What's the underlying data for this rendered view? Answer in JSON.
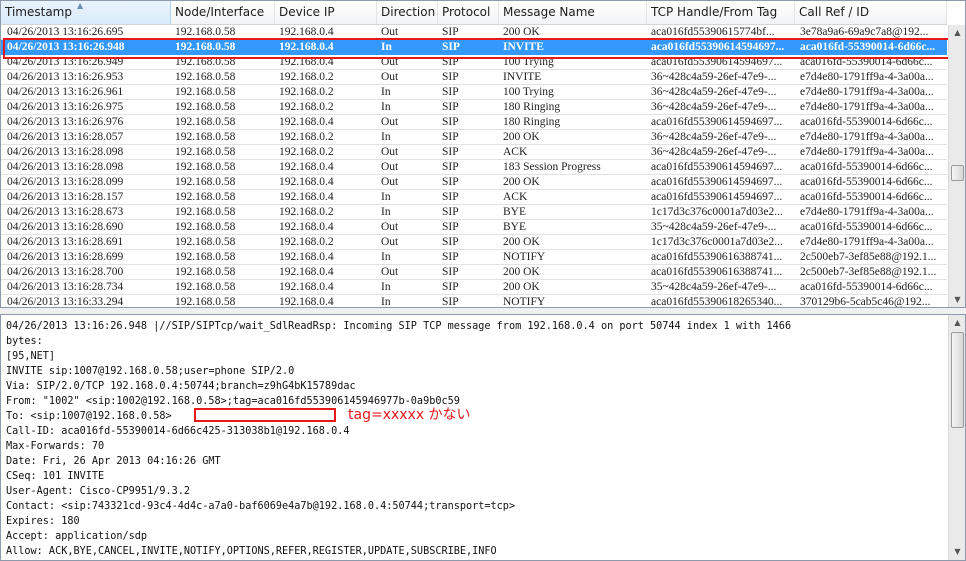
{
  "table": {
    "columns": [
      "Timestamp",
      "Node/Interface",
      "Device IP",
      "Direction",
      "Protocol",
      "Message Name",
      "TCP Handle/From Tag",
      "Call Ref / ID"
    ],
    "rows": [
      [
        "04/26/2013 13:16:26.695",
        "192.168.0.58",
        "192.168.0.4",
        "Out",
        "SIP",
        "200 OK",
        "aca016fd55390615774bf...",
        "3e78a9a6-69a9c7a8@192..."
      ],
      [
        "04/26/2013 13:16:26.948",
        "192.168.0.58",
        "192.168.0.4",
        "In",
        "SIP",
        "INVITE",
        "aca016fd55390614594697...",
        "aca016fd-55390014-6d66c..."
      ],
      [
        "04/26/2013 13:16:26.949",
        "192.168.0.58",
        "192.168.0.4",
        "Out",
        "SIP",
        "100 Trying",
        "aca016fd55390614594697...",
        "aca016fd-55390014-6d66c..."
      ],
      [
        "04/26/2013 13:16:26.953",
        "192.168.0.58",
        "192.168.0.2",
        "Out",
        "SIP",
        "INVITE",
        "36~428c4a59-26ef-47e9-...",
        "e7d4e80-1791ff9a-4-3a00a..."
      ],
      [
        "04/26/2013 13:16:26.961",
        "192.168.0.58",
        "192.168.0.2",
        "In",
        "SIP",
        "100 Trying",
        "36~428c4a59-26ef-47e9-...",
        "e7d4e80-1791ff9a-4-3a00a..."
      ],
      [
        "04/26/2013 13:16:26.975",
        "192.168.0.58",
        "192.168.0.2",
        "In",
        "SIP",
        "180 Ringing",
        "36~428c4a59-26ef-47e9-...",
        "e7d4e80-1791ff9a-4-3a00a..."
      ],
      [
        "04/26/2013 13:16:26.976",
        "192.168.0.58",
        "192.168.0.4",
        "Out",
        "SIP",
        "180 Ringing",
        "aca016fd55390614594697...",
        "aca016fd-55390014-6d66c..."
      ],
      [
        "04/26/2013 13:16:28.057",
        "192.168.0.58",
        "192.168.0.2",
        "In",
        "SIP",
        "200 OK",
        "36~428c4a59-26ef-47e9-...",
        "e7d4e80-1791ff9a-4-3a00a..."
      ],
      [
        "04/26/2013 13:16:28.098",
        "192.168.0.58",
        "192.168.0.2",
        "Out",
        "SIP",
        "ACK",
        "36~428c4a59-26ef-47e9-...",
        "e7d4e80-1791ff9a-4-3a00a..."
      ],
      [
        "04/26/2013 13:16:28.098",
        "192.168.0.58",
        "192.168.0.4",
        "Out",
        "SIP",
        "183 Session Progress",
        "aca016fd55390614594697...",
        "aca016fd-55390014-6d66c..."
      ],
      [
        "04/26/2013 13:16:28.099",
        "192.168.0.58",
        "192.168.0.4",
        "Out",
        "SIP",
        "200 OK",
        "aca016fd55390614594697...",
        "aca016fd-55390014-6d66c..."
      ],
      [
        "04/26/2013 13:16:28.157",
        "192.168.0.58",
        "192.168.0.4",
        "In",
        "SIP",
        "ACK",
        "aca016fd55390614594697...",
        "aca016fd-55390014-6d66c..."
      ],
      [
        "04/26/2013 13:16:28.673",
        "192.168.0.58",
        "192.168.0.2",
        "In",
        "SIP",
        "BYE",
        "1c17d3c376c0001a7d03e2...",
        "e7d4e80-1791ff9a-4-3a00a..."
      ],
      [
        "04/26/2013 13:16:28.690",
        "192.168.0.58",
        "192.168.0.4",
        "Out",
        "SIP",
        "BYE",
        "35~428c4a59-26ef-47e9-...",
        "aca016fd-55390014-6d66c..."
      ],
      [
        "04/26/2013 13:16:28.691",
        "192.168.0.58",
        "192.168.0.2",
        "Out",
        "SIP",
        "200 OK",
        "1c17d3c376c0001a7d03e2...",
        "e7d4e80-1791ff9a-4-3a00a..."
      ],
      [
        "04/26/2013 13:16:28.699",
        "192.168.0.58",
        "192.168.0.4",
        "In",
        "SIP",
        "NOTIFY",
        "aca016fd55390616388741...",
        "2c500eb7-3ef85e88@192.1..."
      ],
      [
        "04/26/2013 13:16:28.700",
        "192.168.0.58",
        "192.168.0.4",
        "Out",
        "SIP",
        "200 OK",
        "aca016fd55390616388741...",
        "2c500eb7-3ef85e88@192.1..."
      ],
      [
        "04/26/2013 13:16:28.734",
        "192.168.0.58",
        "192.168.0.4",
        "In",
        "SIP",
        "200 OK",
        "35~428c4a59-26ef-47e9-...",
        "aca016fd-55390014-6d66c..."
      ],
      [
        "04/26/2013 13:16:33.294",
        "192.168.0.58",
        "192.168.0.4",
        "In",
        "SIP",
        "NOTIFY",
        "aca016fd55390618265340...",
        "370129b6-5cab5c46@192..."
      ]
    ],
    "selected_row": 1
  },
  "detail": {
    "lines": [
      "04/26/2013 13:16:26.948 |//SIP/SIPTcp/wait_SdlReadRsp: Incoming SIP TCP message from 192.168.0.4 on port 50744 index 1 with 1466",
      "bytes:",
      "[95,NET]",
      "INVITE sip:1007@192.168.0.58;user=phone SIP/2.0",
      "Via: SIP/2.0/TCP 192.168.0.4:50744;branch=z9hG4bK15789dac",
      "From: \"1002\" <sip:1002@192.168.0.58>;tag=aca016fd553906145946977b-0a9b0c59",
      "To: <sip:1007@192.168.0.58>",
      "Call-ID: aca016fd-55390014-6d66c425-313038b1@192.168.0.4",
      "Max-Forwards: 70",
      "Date: Fri, 26 Apr 2013 04:16:26 GMT",
      "CSeq: 101 INVITE",
      "User-Agent: Cisco-CP9951/9.3.2",
      "Contact: <sip:743321cd-93c4-4d4c-a7a0-baf6069e4a7b@192.168.0.4:50744;transport=tcp>",
      "Expires: 180",
      "Accept: application/sdp",
      "Allow: ACK,BYE,CANCEL,INVITE,NOTIFY,OPTIONS,REFER,REGISTER,UPDATE,SUBSCRIBE,INFO"
    ],
    "annotation": "tag=xxxxx かない"
  },
  "icons": {
    "scroll_up": "up-arrow-icon",
    "scroll_down": "down-arrow-icon",
    "sort_indicator": "sort-arrow-icon"
  },
  "colors": {
    "selection": "#3399ff",
    "highlight_box": "#e61919"
  }
}
